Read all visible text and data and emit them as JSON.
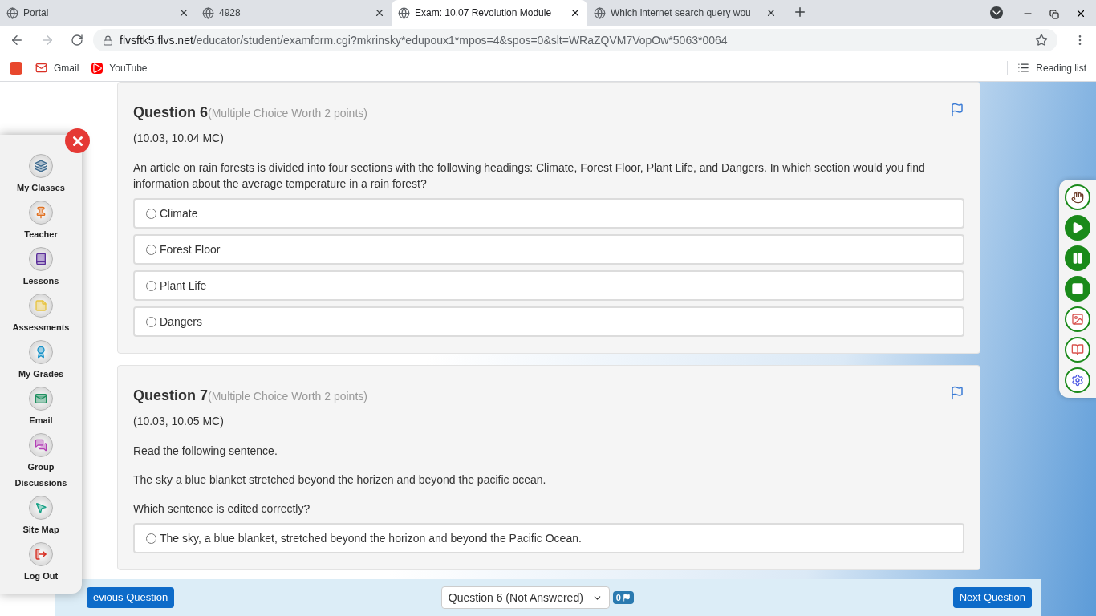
{
  "browser": {
    "tabs": [
      {
        "title": "Portal",
        "selected": false
      },
      {
        "title": "4928",
        "selected": false
      },
      {
        "title": "Exam: 10.07 Revolution Module",
        "selected": true
      },
      {
        "title": "Which internet search query wou",
        "selected": false
      }
    ],
    "url_host": "flvsftk5.flvs.net",
    "url_path": "/educator/student/examform.cgi?mkrinsky*edupoux1*mpos=4&spos=0&slt=WRaZQVM7VopOw*5063*0064",
    "bookmarks": [
      "Gmail",
      "YouTube"
    ],
    "reading_list": "Reading list"
  },
  "sidebar": {
    "items": [
      "My Classes",
      "Teacher",
      "Lessons",
      "Assessments",
      "My Grades",
      "Email",
      "Group Discussions",
      "Site Map",
      "Log Out"
    ]
  },
  "questions": [
    {
      "title": "Question 6",
      "worth": "(Multiple Choice Worth 2 points)",
      "code": "(10.03, 10.04 MC)",
      "paragraphs": [
        "An article on rain forests is divided into four sections with the following headings: Climate, Forest Floor, Plant Life, and Dangers. In which section would you find information about the average temperature in a rain forest?"
      ],
      "options": [
        {
          "label": "Climate",
          "selected": false
        },
        {
          "label": "Forest Floor",
          "selected": false
        },
        {
          "label": "Plant Life",
          "selected": false
        },
        {
          "label": "Dangers",
          "selected": false
        }
      ]
    },
    {
      "title": "Question 7",
      "worth": "(Multiple Choice Worth 2 points)",
      "code": "(10.03, 10.05 MC)",
      "paragraphs": [
        "Read the following sentence.",
        "The sky a blue blanket stretched beyond the horizen and beyond the pacific ocean.",
        "Which sentence is edited correctly?"
      ],
      "options": [
        {
          "label": "The sky, a blue blanket, stretched beyond the horizon and beyond the Pacific Ocean.",
          "selected": false
        }
      ]
    }
  ],
  "footer": {
    "previous": "evious Question",
    "question_select": "Question 6 (Not Answered)",
    "flag_count": "0",
    "next": "Next Question"
  }
}
